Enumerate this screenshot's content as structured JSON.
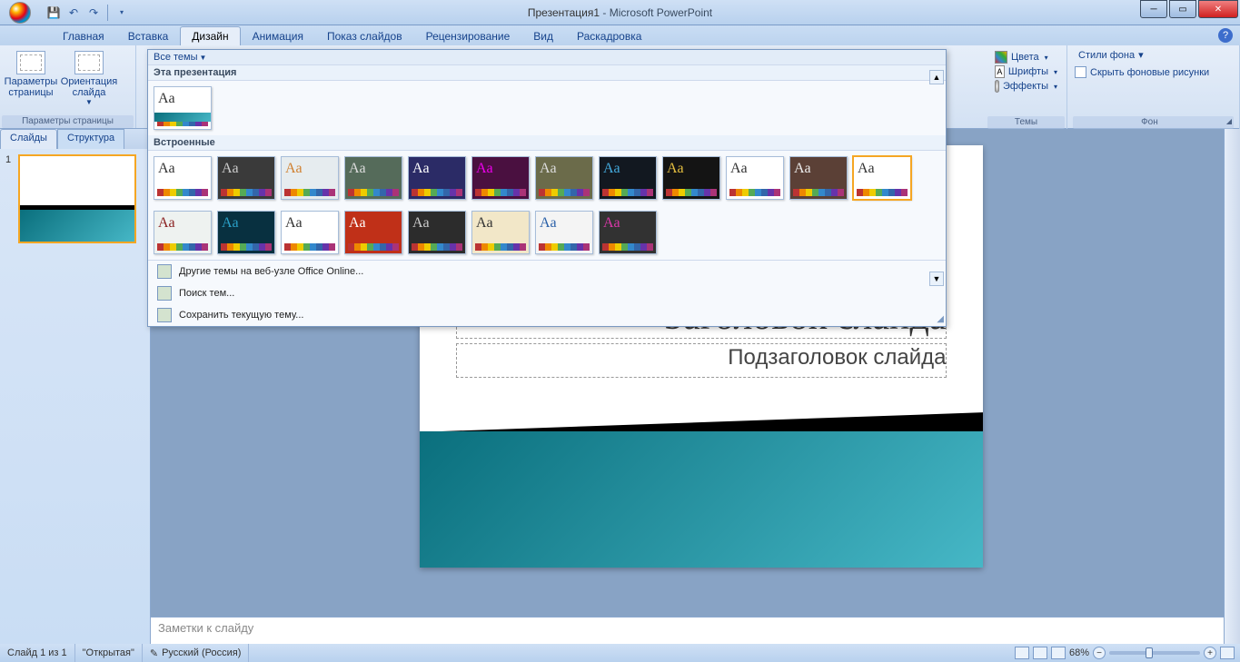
{
  "title": {
    "document": "Презентация1",
    "app": "Microsoft PowerPoint"
  },
  "tabs": {
    "items": [
      "Главная",
      "Вставка",
      "Дизайн",
      "Анимация",
      "Показ слайдов",
      "Рецензирование",
      "Вид",
      "Раскадровка"
    ],
    "active": "Дизайн"
  },
  "ribbon": {
    "page_setup": {
      "label": "Параметры страницы",
      "buttons": {
        "page_params": "Параметры\nстраницы",
        "orientation": "Ориентация\nслайда"
      }
    },
    "themes_group_label": "Темы",
    "theme_controls": {
      "colors": "Цвета",
      "fonts": "Шрифты",
      "effects": "Эффекты"
    },
    "background": {
      "styles": "Стили фона",
      "hide_graphics": "Скрыть фоновые рисунки",
      "label": "Фон"
    }
  },
  "dropdown": {
    "all_themes": "Все темы",
    "this_presentation": "Эта презентация",
    "builtin": "Встроенные",
    "footer": {
      "more": "Другие темы на веб-узле Office Online...",
      "browse": "Поиск тем...",
      "save": "Сохранить текущую тему..."
    },
    "themes_row1": [
      {
        "aa": "#333",
        "bg": "#ffffff"
      },
      {
        "aa": "#ccc",
        "bg": "#3a3a3a"
      },
      {
        "aa": "#d08030",
        "bg": "#e6ecef"
      },
      {
        "aa": "#ddd",
        "bg": "#556b5a"
      },
      {
        "aa": "#fff",
        "bg": "#2b2b66"
      },
      {
        "aa": "#e0e",
        "bg": "#4a1040"
      },
      {
        "aa": "#ddd",
        "bg": "#6b6b4a"
      },
      {
        "aa": "#4ad",
        "bg": "#121820"
      },
      {
        "aa": "#e6c040",
        "bg": "#141414"
      },
      {
        "aa": "#333",
        "bg": "#ffffff"
      },
      {
        "aa": "#eee",
        "bg": "#5b4036"
      },
      {
        "aa": "#333",
        "bg": "#ffffff",
        "selected": true
      }
    ],
    "themes_row2": [
      {
        "aa": "#8a2020",
        "bg": "#eef2f0"
      },
      {
        "aa": "#2aa0c8",
        "bg": "#083040"
      },
      {
        "aa": "#333",
        "bg": "#ffffff"
      },
      {
        "aa": "#fff",
        "bg": "#c03018"
      },
      {
        "aa": "#ccc",
        "bg": "#2c2c2c"
      },
      {
        "aa": "#333",
        "bg": "#f2e7c8"
      },
      {
        "aa": "#2a60a8",
        "bg": "#f4f4f4"
      },
      {
        "aa": "#d938a8",
        "bg": "#323232"
      }
    ],
    "swatch_colors": [
      "#b33",
      "#e80",
      "#ec0",
      "#5a5",
      "#38c",
      "#36a",
      "#63a",
      "#a37"
    ]
  },
  "leftpane": {
    "tabs": {
      "slides": "Слайды",
      "outline": "Структура"
    },
    "slide_num": "1"
  },
  "slide": {
    "title": "Заголовок слайда",
    "subtitle": "Подзаголовок слайда"
  },
  "notes": {
    "placeholder": "Заметки к слайду"
  },
  "status": {
    "slide_counter": "Слайд 1 из 1",
    "theme": "\"Открытая\"",
    "lang": "Русский (Россия)",
    "zoom": "68%"
  }
}
